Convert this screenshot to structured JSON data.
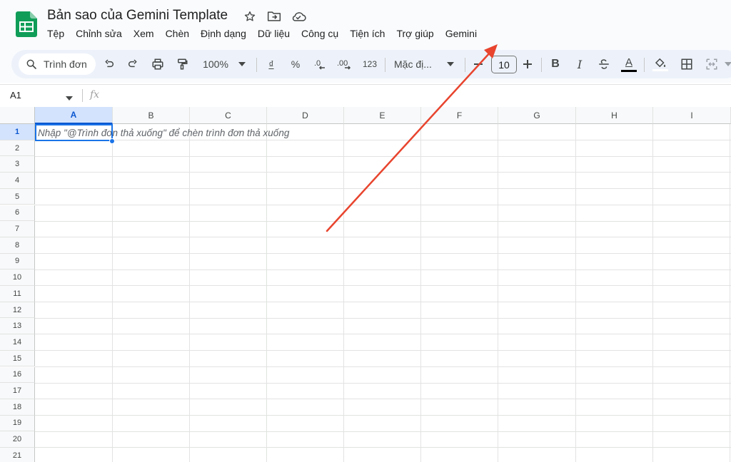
{
  "document": {
    "title": "Bản sao của Gemini Template"
  },
  "menu": [
    "Tệp",
    "Chỉnh sửa",
    "Xem",
    "Chèn",
    "Định dạng",
    "Dữ liệu",
    "Công cụ",
    "Tiện ích",
    "Trợ giúp",
    "Gemini"
  ],
  "toolbar": {
    "search_label": "Trình đơn",
    "zoom": "100%",
    "currency": "₫",
    "percent": "%",
    "number_format": "123",
    "font_name": "Mặc đị...",
    "font_size": "10",
    "bold": "B",
    "italic": "I",
    "text_color_letter": "A"
  },
  "formula_bar": {
    "cell_ref": "A1",
    "fx": "fx"
  },
  "sheet": {
    "columns": [
      "A",
      "B",
      "C",
      "D",
      "E",
      "F",
      "G",
      "H",
      "I"
    ],
    "rows": [
      "1",
      "2",
      "3",
      "4",
      "5",
      "6",
      "7",
      "8",
      "9",
      "10",
      "11",
      "12",
      "13",
      "14",
      "15",
      "16",
      "17",
      "18",
      "19",
      "20",
      "21"
    ],
    "selected_cell": "A1",
    "cell_a1_hint": "Nhập \"@Trình đơn thả xuống\" để chèn trình đơn thả xuống"
  },
  "colors": {
    "brand_green": "#0f9d58",
    "selection_blue": "#1a73e8",
    "annotation_arrow": "#e8442e"
  }
}
